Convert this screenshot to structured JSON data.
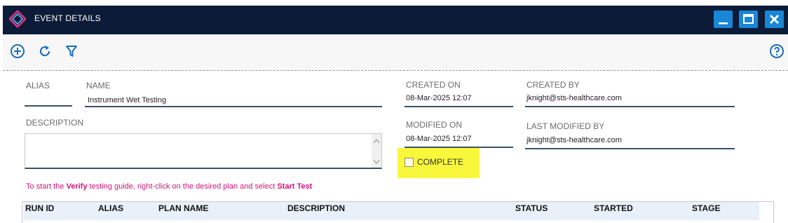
{
  "window": {
    "title": "EVENT DETAILS",
    "controls": [
      "minimize",
      "maximize",
      "close"
    ]
  },
  "toolbar": {
    "icons": [
      "add-icon",
      "refresh-icon",
      "filter-icon",
      "help-icon"
    ]
  },
  "form": {
    "alias_label": "ALIAS",
    "alias_value": "",
    "name_label": "NAME",
    "name_value": "Instrument Wet Testing",
    "description_label": "DESCRIPTION",
    "description_value": "",
    "created_on_label": "CREATED ON",
    "created_on_value": "08-Mar-2025 12:07",
    "created_by_label": "CREATED BY",
    "created_by_value": "jknight@sts-healthcare.com",
    "modified_on_label": "MODIFIED ON",
    "modified_on_value": "08-Mar-2025 12:07",
    "last_modified_by_label": "LAST MODIFIED BY",
    "last_modified_by_value": "jknight@sts-healthcare.com",
    "complete_label": "COMPLETE",
    "complete_checked": false
  },
  "hint": {
    "part1": "To start the ",
    "bold1": "Verify",
    "part2": " testing guide, right-click on the desired plan and select ",
    "bold2": "Start Test"
  },
  "table": {
    "columns": [
      "RUN ID",
      "ALIAS",
      "PLAN NAME",
      "DESCRIPTION",
      "STATUS",
      "STARTED",
      "STAGE"
    ]
  },
  "colors": {
    "titlebar": "#0c1b37",
    "window_button": "#1a86d6",
    "hint_text": "#d4147a",
    "highlight": "#f9f73c"
  }
}
